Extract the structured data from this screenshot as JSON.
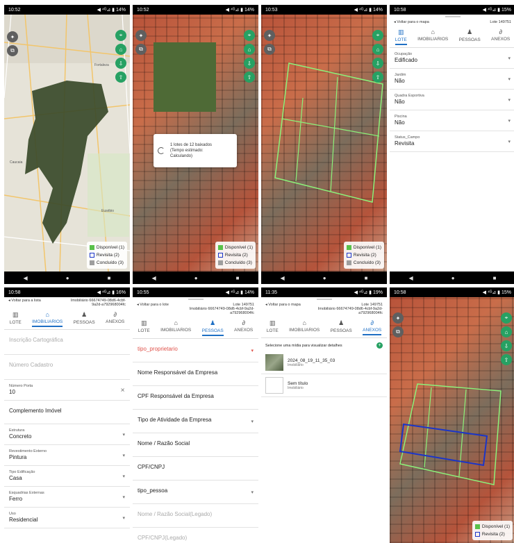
{
  "panels": [
    {
      "time": "10:52",
      "battery": "◀ ⁴ᴳ⊿ ▮ 14%"
    },
    {
      "time": "10:52",
      "battery": "◀ ⁴ᴳ⊿ ▮ 14%"
    },
    {
      "time": "10:53",
      "battery": "◀ ⁴ᴳ⊿ ▮ 14%"
    },
    {
      "time": "10:58",
      "battery": "◀ ⁴ᴳ⊿ ▮ 15%"
    },
    {
      "time": "10:58",
      "battery": "◀ ⁴ᴳ⊿ ▮ 16%"
    },
    {
      "time": "10:55",
      "battery": "◀ ⁴ᴳ⊿ ▮ 14%"
    },
    {
      "time": "11:35",
      "battery": "◀ ⁴ᴳ⊿ ▮ 19%"
    },
    {
      "time": "10:58",
      "battery": "◀ ⁴ᴳ⊿ ▮ 15%"
    }
  ],
  "legend": {
    "available": "Disponível (1)",
    "revisit": "Revisita (2)",
    "done": "Concluído (3)"
  },
  "legend_short": {
    "available": "Disponível (1)",
    "revisit": "Revisita (2)"
  },
  "colors": {
    "available": "#59c14a",
    "revisit": "#1a35c9",
    "done": "#9e9e9e",
    "accent": "#1e6fc4",
    "fab": "#27a163"
  },
  "map_labels": {
    "a": "Itaqui",
    "b": "Fortaleza",
    "c": "Maracanaú",
    "d": "Caucaia",
    "e": "Pacatuba",
    "f": "Aquiraz",
    "g": "Eusébio",
    "h": "Itaitinga"
  },
  "loading": {
    "line1": "1 lotes de 12 baixados",
    "line2": "(Tempo estimado:",
    "line3": "Calculando)"
  },
  "tabs": {
    "lote": "LOTE",
    "imobiliarios": "IMOBILIARIOS",
    "pessoas": "PESSOAS",
    "anexos": "ANEXOS"
  },
  "lote_screen": {
    "back": "◂ Voltar para o mapa",
    "lote_id": "Lote 149751",
    "fields": [
      {
        "label": "Ocupação",
        "value": "Edificado"
      },
      {
        "label": "Jardim",
        "value": "Não"
      },
      {
        "label": "Quadra Esportiva",
        "value": "Não"
      },
      {
        "label": "Piscina",
        "value": "Não"
      },
      {
        "label": "Status_Campo",
        "value": "Revisita"
      }
    ]
  },
  "imob_screen": {
    "back": "◂ Voltar para a lista",
    "imob_id": "Imobiliário 66674749-08d6-4cbf-9a2d-a792968004fc",
    "placeholders": [
      "Inscrição Cartográfica",
      "Número Cadastro"
    ],
    "num_porta_label": "Número Porta",
    "num_porta_value": "10",
    "clear": "✕",
    "complemento": "Complemento Imóvel",
    "fields": [
      {
        "label": "Estrutura",
        "value": "Concreto"
      },
      {
        "label": "Revestimento Externo",
        "value": "Pintura"
      },
      {
        "label": "Tipo Edificação",
        "value": "Casa"
      },
      {
        "label": "Esquadrias Externas",
        "value": "Ferro"
      },
      {
        "label": "Uso",
        "value": "Residencial"
      }
    ]
  },
  "pessoas_screen": {
    "back": "◂ Voltar para o lote",
    "lote_id": "Lote 149751",
    "imob_id": "Imobiliário 66674749-08d6-4cbf-9a2d-a792968004fc",
    "tipo_proprietario": "tipo_proprietario",
    "items": [
      "Nome Responsável da Empresa",
      "CPF Responsável da Empresa",
      "Tipo de Atividade da Empresa",
      "Nome / Razão Social",
      "CPF/CNPJ",
      "tipo_pessoa"
    ],
    "legacy": [
      "Nome / Razão Social(Legado)",
      "CPF/CNPJ(Legado)"
    ]
  },
  "anexos_screen": {
    "back": "◂ Voltar para o mapa",
    "lote_id": "Lote 149751",
    "imob_id": "Imobiliário 66674749-08d6-4cbf-9a2d-a792968004fc",
    "prompt": "Selecione uma mídia para visualizar detalhes",
    "items": [
      {
        "title": "2024_08_19_11_35_03",
        "sub": "Imobiliário"
      },
      {
        "title": "Sem título",
        "sub": "Imobiliário"
      }
    ]
  },
  "nav": {
    "back": "◀",
    "home": "●",
    "recent": "■"
  }
}
